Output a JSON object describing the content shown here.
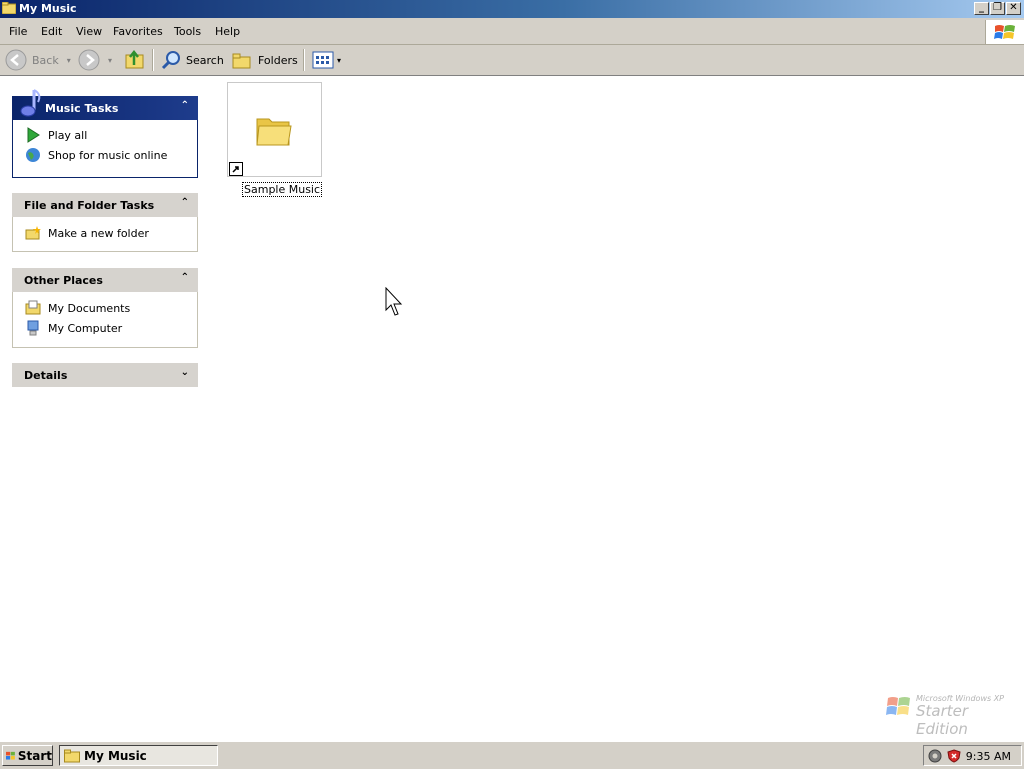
{
  "window": {
    "title": "My Music"
  },
  "menu": [
    "File",
    "Edit",
    "View",
    "Favorites",
    "Tools",
    "Help"
  ],
  "toolbar": {
    "back": "Back",
    "search": "Search",
    "folders": "Folders"
  },
  "tasks": {
    "music": {
      "title": "Music Tasks",
      "items": [
        "Play all",
        "Shop for music online"
      ]
    },
    "file_folder": {
      "title": "File and Folder Tasks",
      "items": [
        "Make a new folder"
      ]
    },
    "other_places": {
      "title": "Other Places",
      "items": [
        "My Documents",
        "My Computer"
      ]
    },
    "details": {
      "title": "Details"
    }
  },
  "content": {
    "items": [
      {
        "label": "Sample Music",
        "icon": "folder-shortcut-icon"
      }
    ]
  },
  "taskbar": {
    "start": "Start",
    "active_window": "My Music",
    "clock": "9:35 AM"
  },
  "watermark": {
    "line1": "Microsoft Windows XP",
    "line2": "Starter Edition"
  }
}
